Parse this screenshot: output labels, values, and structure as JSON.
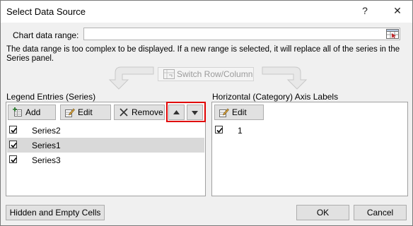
{
  "window": {
    "title": "Select Data Source",
    "help_glyph": "?",
    "close_glyph": "✕"
  },
  "range": {
    "label": "Chart data range:",
    "value": "",
    "message": "The data range is too complex to be displayed. If a new range is selected, it will replace all of the series in the Series panel."
  },
  "switch_label": "Switch Row/Column",
  "legend": {
    "heading": "Legend Entries (Series)",
    "add_label": "Add",
    "edit_label": "Edit",
    "remove_label": "Remove",
    "move_up_icon": "triangle-up",
    "move_down_icon": "triangle-down",
    "items": [
      {
        "label": "Series2",
        "checked": true,
        "selected": false
      },
      {
        "label": "Series1",
        "checked": true,
        "selected": true
      },
      {
        "label": "Series3",
        "checked": true,
        "selected": false
      }
    ]
  },
  "axis": {
    "heading": "Horizontal (Category) Axis Labels",
    "edit_label": "Edit",
    "items": [
      {
        "label": "1",
        "checked": true
      }
    ]
  },
  "footer": {
    "hidden_cells_label": "Hidden and Empty Cells",
    "ok_label": "OK",
    "cancel_label": "Cancel"
  },
  "colors": {
    "highlight_border": "#e00000",
    "selected_row": "#d9d9d9",
    "button_face": "#e1e1e1"
  }
}
